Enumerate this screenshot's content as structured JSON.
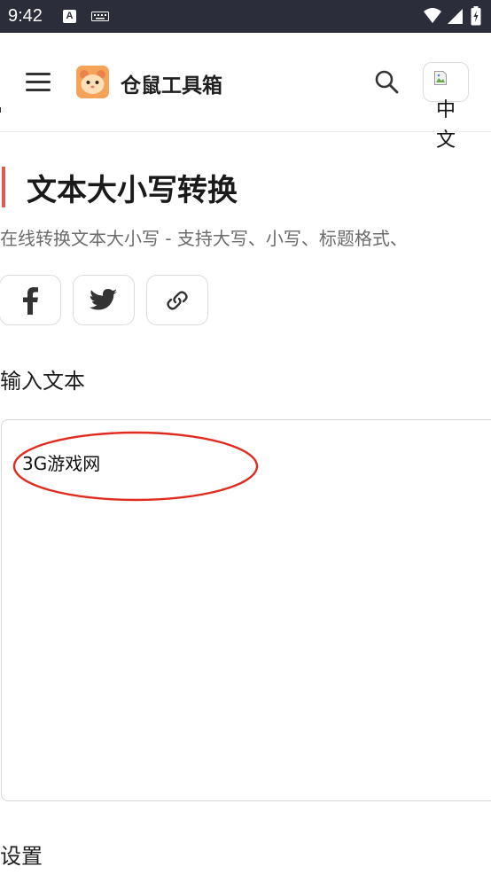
{
  "status_bar": {
    "time": "9:42",
    "a_icon_label": "A",
    "icons": [
      "a-icon",
      "keyboard-icon",
      "wifi-icon",
      "signal-icon",
      "battery-icon"
    ]
  },
  "app_bar": {
    "title": "仓鼠工具箱",
    "lang_label": "中文",
    "icons": [
      "menu-icon",
      "hamster-logo-icon",
      "search-icon",
      "broken-image-icon"
    ]
  },
  "page": {
    "title": "文本大小写转换",
    "description": "在线转换文本大小写 - 支持大写、小写、标题格式、",
    "accent_color": "#e05a4e"
  },
  "share": {
    "icons": [
      "facebook-icon",
      "twitter-icon",
      "link-icon"
    ]
  },
  "input": {
    "label": "输入文本",
    "value": "3G游戏网"
  },
  "settings": {
    "label": "设置"
  },
  "annotation": {
    "color": "#e02b20"
  }
}
